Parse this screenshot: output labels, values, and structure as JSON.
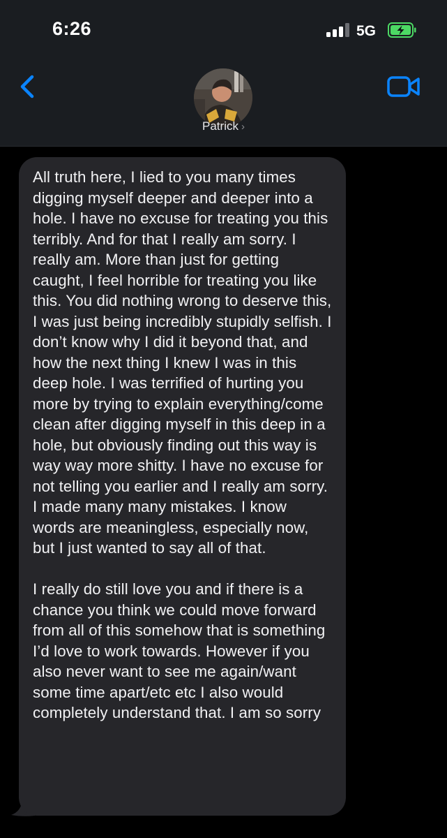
{
  "status_bar": {
    "time": "6:26",
    "network": "5G",
    "signal_icon": "cellular-signal-icon",
    "battery_icon": "battery-charging-icon",
    "battery_color": "#4cd964"
  },
  "header": {
    "back_icon": "chevron-left-icon",
    "video_icon": "facetime-video-icon",
    "contact_name": "Patrick",
    "contact_chevron": "›",
    "accent_color": "#0a84ff"
  },
  "message": {
    "direction": "incoming",
    "bubble_color": "#26262a",
    "paragraphs": [
      "All truth here, I lied to you many times digging myself deeper and deeper into a hole. I have no excuse for treating you this terribly. And for that I really am sorry. I really am. More than just for getting caught, I feel horrible for treating you like this. You did nothing wrong to deserve this, I was just being incredibly stupidly selfish. I don’t know why I did it beyond that, and how the next thing I knew I was in this deep hole. I was terrified of hurting you more by trying to explain everything/come clean after digging myself in this deep in a hole, but obviously finding out this way is way way more shitty. I have no excuse for not telling you earlier and I really am sorry. I made many many mistakes. I know words are meaningless, especially now, but I just wanted to say all of that.",
      "I really do still love you and if there is a chance you think we could move forward from all of this somehow that is something I’d love to work towards. However if you also never want to see me again/want some time apart/etc etc I also would completely understand that. I am so sorry"
    ]
  }
}
